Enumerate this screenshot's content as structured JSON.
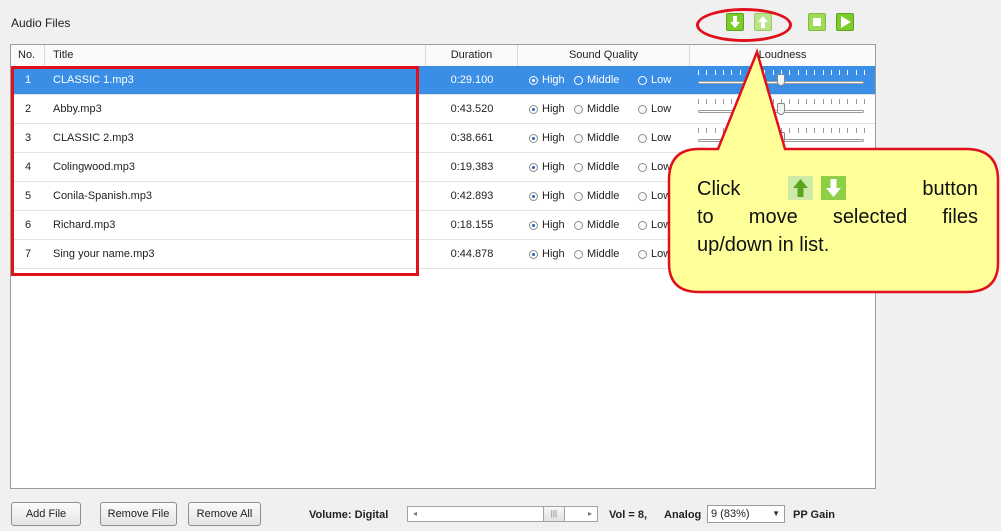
{
  "panel": {
    "title": "Audio Files"
  },
  "toolbar": {
    "move_down_icon": "arrow-down-icon",
    "move_up_icon": "arrow-up-icon",
    "stop_icon": "stop-icon",
    "play_icon": "play-icon"
  },
  "table": {
    "columns": {
      "no": "No.",
      "title": "Title",
      "duration": "Duration",
      "quality": "Sound Quality",
      "loudness": "Loudness"
    },
    "quality_options": {
      "high": "High",
      "middle": "Middle",
      "low": "Low"
    },
    "rows": [
      {
        "no": "1",
        "title": "CLASSIC 1.mp3",
        "duration": "0:29.100",
        "quality": "High",
        "selected": true,
        "loudness": 0.5
      },
      {
        "no": "2",
        "title": "Abby.mp3",
        "duration": "0:43.520",
        "quality": "High",
        "selected": false,
        "loudness": 0.5
      },
      {
        "no": "3",
        "title": "CLASSIC 2.mp3",
        "duration": "0:38.661",
        "quality": "High",
        "selected": false,
        "loudness": 0.5
      },
      {
        "no": "4",
        "title": "Colingwood.mp3",
        "duration": "0:19.383",
        "quality": "High",
        "selected": false,
        "loudness": 0.5
      },
      {
        "no": "5",
        "title": "Conila-Spanish.mp3",
        "duration": "0:42.893",
        "quality": "High",
        "selected": false,
        "loudness": 0.5
      },
      {
        "no": "6",
        "title": "Richard.mp3",
        "duration": "0:18.155",
        "quality": "High",
        "selected": false,
        "loudness": 0.5
      },
      {
        "no": "7",
        "title": "Sing your name.mp3",
        "duration": "0:44.878",
        "quality": "High",
        "selected": false,
        "loudness": 0.5
      }
    ]
  },
  "footer": {
    "add_file": "Add File",
    "remove_file": "Remove File",
    "remove_all": "Remove All",
    "volume_label": "Volume:  Digital",
    "digital_level": 0.87,
    "vol_text": "Vol = 8,",
    "analog_label": "Analog",
    "analog_value": "9 (83%)",
    "pp_gain": "PP Gain"
  },
  "callout": {
    "word_click": "Click",
    "word_button": "button",
    "line2": [
      "to",
      "move",
      "selected",
      "files"
    ],
    "line3": "up/down in list."
  },
  "colors": {
    "selection": "#3a8ee6",
    "annotation_red": "#e0101d",
    "callout_fill": "#ffff99",
    "button_green": "#7ccc2b"
  }
}
